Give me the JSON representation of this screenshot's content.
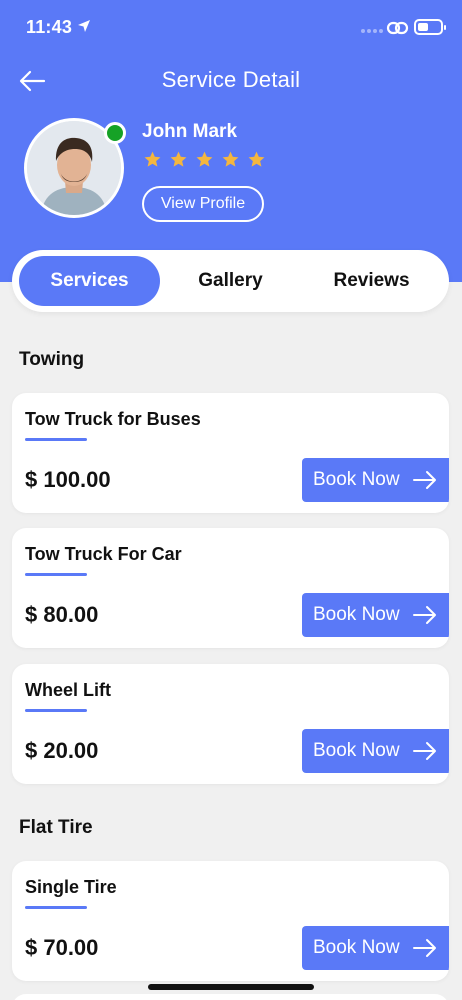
{
  "status_bar": {
    "time": "11:43"
  },
  "header": {
    "title": "Service Detail"
  },
  "profile": {
    "name": "John Mark",
    "rating": 5,
    "online": true,
    "view_profile_label": "View Profile"
  },
  "tabs": [
    {
      "label": "Services",
      "active": true
    },
    {
      "label": "Gallery",
      "active": false
    },
    {
      "label": "Reviews",
      "active": false
    }
  ],
  "sections": [
    {
      "title": "Towing",
      "services": [
        {
          "name": "Tow Truck for Buses",
          "price": "$ 100.00",
          "button": "Book Now"
        },
        {
          "name": "Tow Truck For Car",
          "price": "$ 80.00",
          "button": "Book Now"
        },
        {
          "name": "Wheel Lift",
          "price": "$ 20.00",
          "button": "Book Now"
        }
      ]
    },
    {
      "title": "Flat Tire",
      "services": [
        {
          "name": "Single Tire",
          "price": "$ 70.00",
          "button": "Book Now"
        }
      ]
    }
  ],
  "colors": {
    "primary": "#5a79f7",
    "online": "#16a226",
    "star": "#f4b63f",
    "background": "#f0f0f0"
  },
  "icons": {
    "back": "arrow-left-icon",
    "location": "location-arrow-icon",
    "link": "link-icon",
    "battery": "battery-icon",
    "star": "star-icon",
    "book": "arrow-right-icon"
  }
}
